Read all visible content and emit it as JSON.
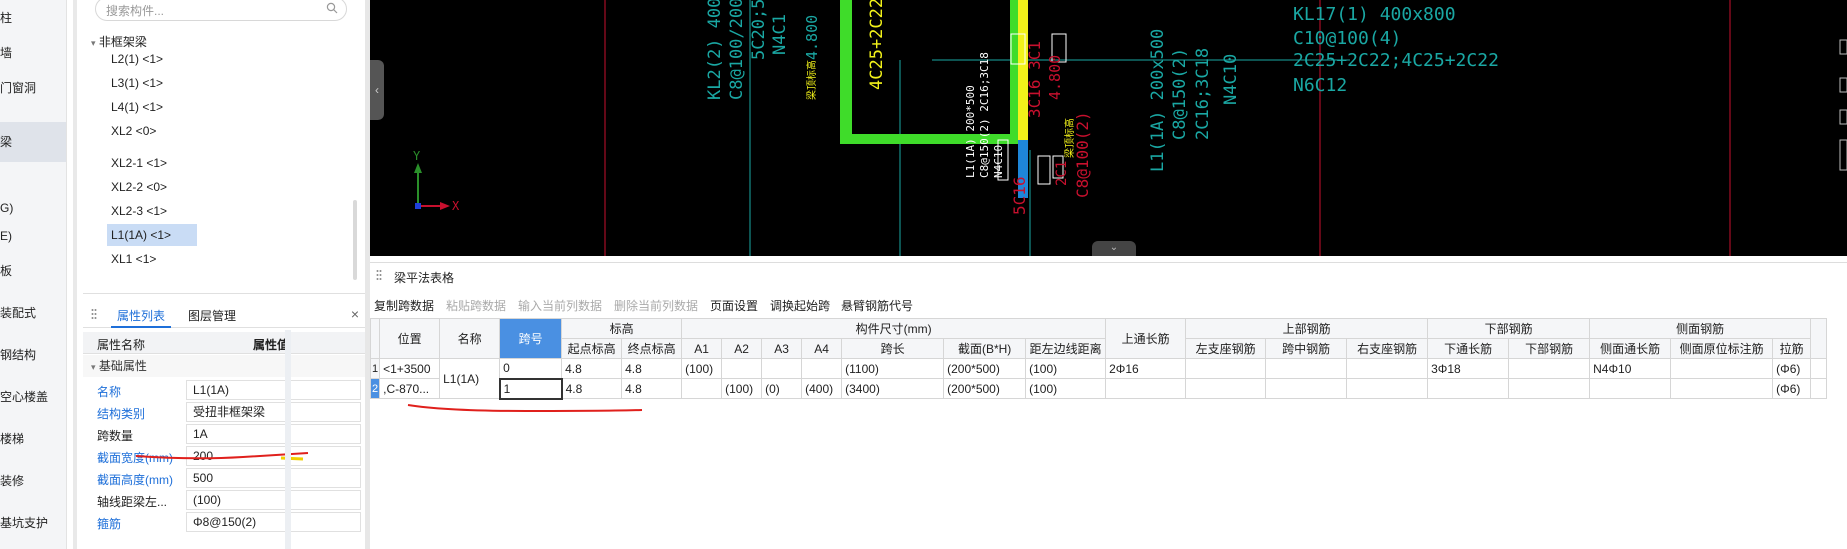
{
  "sidebar": {
    "categories": [
      {
        "label": "柱"
      },
      {
        "label": "墙"
      },
      {
        "label": "门窗洞"
      },
      {
        "label": "梁"
      },
      {
        "label": "G)"
      },
      {
        "label": "E)"
      },
      {
        "label": "板"
      },
      {
        "label": "装配式"
      },
      {
        "label": "钢结构"
      },
      {
        "label": "空心楼盖"
      },
      {
        "label": "楼梯"
      },
      {
        "label": "装修"
      },
      {
        "label": "基坑支护"
      }
    ]
  },
  "component_list": {
    "search_placeholder": "搜索构件...",
    "group_label": "非框架梁",
    "items": [
      {
        "label": "L2(1) <1>"
      },
      {
        "label": "L3(1) <1>"
      },
      {
        "label": "L4(1) <1>"
      },
      {
        "label": "XL2 <0>"
      },
      {
        "label": "XL2-1 <1>"
      },
      {
        "label": "XL2-2 <0>"
      },
      {
        "label": "XL2-3 <1>"
      },
      {
        "label": "L1(1A) <1>"
      },
      {
        "label": "XL1 <1>"
      }
    ]
  },
  "attributes": {
    "tab_properties": "属性列表",
    "tab_layers": "图层管理",
    "close_symbol": "×",
    "col_name": "属性名称",
    "col_value": "属性值",
    "group_basic": "基础属性",
    "rows": [
      {
        "key": "名称",
        "value": "L1(1A)"
      },
      {
        "key": "结构类别",
        "value": "受扭非框架梁"
      },
      {
        "key": "跨数量",
        "value": "1A"
      },
      {
        "key": "截面宽度(mm)",
        "value": "200"
      },
      {
        "key": "截面高度(mm)",
        "value": "500"
      },
      {
        "key": "轴线距梁左...",
        "value": "(100)"
      },
      {
        "key": "箍筋",
        "value": "Φ8@150(2)"
      }
    ]
  },
  "cad": {
    "texts": {
      "kl2": "KL2(2) 400x600",
      "c8_100_200": "C8@100/200(4)",
      "c5c2": "5C20;5C2",
      "n4c1": "N4C1",
      "h4800a": "4.800",
      "fan_a": "梁顶标高",
      "c4c25": "4C25+2C22",
      "l1_label": "L1(1A) 200*500",
      "l1_c8": "C8@150(2) 2C16;3C18",
      "l1_n4": "N4C10",
      "c3c16": "3C16 3C1",
      "h4800b": "4.800",
      "fan_b": "梁顶标高",
      "c5c16": "5C16",
      "c2c": "2C1",
      "c8_100": "C8@100(2)",
      "l1_right": "L1(1A) 200x500",
      "c8_150": "C8@150(2)",
      "c2c16": "2C16;3C18",
      "n4c10": "N4C10",
      "kl17": "KL17(1) 400x800",
      "c10": "C10@100(4)",
      "c2c25": "2C25+2C22;4C25+2C22",
      "n6c12": "N6C12",
      "axis_x": "X",
      "axis_y": "Y"
    }
  },
  "beam_table": {
    "title": "梁平法表格",
    "toolbar": [
      {
        "label": "复制跨数据",
        "enabled": true
      },
      {
        "label": "粘贴跨数据",
        "enabled": false
      },
      {
        "label": "输入当前列数据",
        "enabled": false
      },
      {
        "label": "删除当前列数据",
        "enabled": false
      },
      {
        "label": "页面设置",
        "enabled": true
      },
      {
        "label": "调换起始跨",
        "enabled": true
      },
      {
        "label": "悬臂钢筋代号",
        "enabled": true
      }
    ],
    "group_headers": {
      "position": "位置",
      "name": "名称",
      "span_no": "跨号",
      "elevation": "标高",
      "dimensions": "构件尺寸(mm)",
      "top_through": "上通长筋",
      "top_rebar": "上部钢筋",
      "bottom_rebar": "下部钢筋",
      "side_rebar": "侧面钢筋"
    },
    "sub_headers": {
      "start_elev": "起点标高",
      "end_elev": "终点标高",
      "a1": "A1",
      "a2": "A2",
      "a3": "A3",
      "a4": "A4",
      "span_len": "跨长",
      "section": "截面(B*H)",
      "left_edge": "距左边线距离",
      "left_support": "左支座钢筋",
      "mid_span": "跨中钢筋",
      "right_support": "右支座钢筋",
      "bottom_through": "下通长筋",
      "bottom_part": "下部钢筋",
      "side_through": "侧面通长筋",
      "side_original": "侧面原位标注筋",
      "tie": "拉筋"
    },
    "rows": [
      {
        "row_no": "1",
        "position": "<1+3500",
        "name": "L1(1A)",
        "span_no": "0",
        "start_elev": "4.8",
        "end_elev": "4.8",
        "a1": "(100)",
        "a2": "",
        "a3": "",
        "a4": "",
        "span_len": "(1100)",
        "section": "(200*500)",
        "left_edge": "(100)",
        "top_through": "2Φ16",
        "left_support": "",
        "mid_span": "",
        "right_support": "",
        "bottom_through": "3Φ18",
        "bottom_part": "",
        "side_through": "N4Φ10",
        "side_original": "",
        "tie": "(Φ6)"
      },
      {
        "row_no": "2",
        "position": ",C-870...",
        "name": "",
        "span_no": "1",
        "start_elev": "4.8",
        "end_elev": "4.8",
        "a1": "",
        "a2": "(100)",
        "a3": "(0)",
        "a4": "(400)",
        "span_len": "(3400)",
        "section": "(200*500)",
        "left_edge": "(100)",
        "top_through": "",
        "left_support": "",
        "mid_span": "",
        "right_support": "",
        "bottom_through": "",
        "bottom_part": "",
        "side_through": "",
        "side_original": "",
        "tie": "(Φ6)"
      }
    ]
  },
  "colors": {
    "accent": "#1e6fd9",
    "header_highlight": "#4a90e2",
    "cad_bg": "#000000",
    "cad_green": "#3fdc2a",
    "cad_yellow": "#f2f21a",
    "cad_teal": "#1aa7a3",
    "cad_red": "#c8102e",
    "annotation_red": "#e0201c"
  }
}
